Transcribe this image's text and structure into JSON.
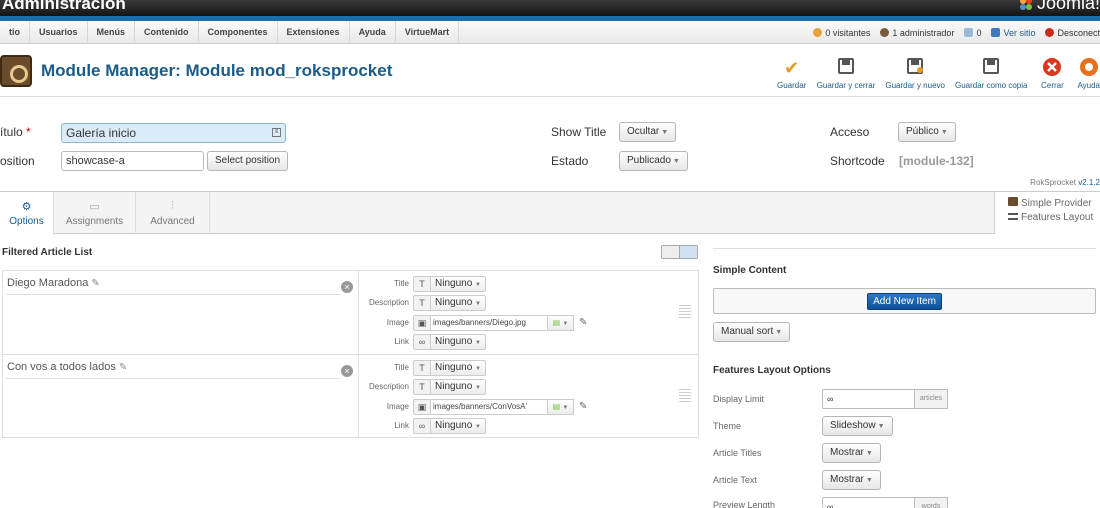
{
  "header": {
    "title": "Administración",
    "brand": "Joomla!"
  },
  "menubar": {
    "items": [
      "tio",
      "Usuarios",
      "Menús",
      "Contenido",
      "Componentes",
      "Extensiones",
      "Ayuda",
      "VirtueMart"
    ],
    "status": {
      "visitors": "0 visitantes",
      "admins": "1 administrador",
      "messages": "0",
      "view_site": "Ver sitio",
      "logout": "Desconect"
    }
  },
  "toolbar": {
    "title": "Module Manager: Module mod_roksprocket",
    "buttons": [
      {
        "label": "Guardar",
        "icon": "check-icon"
      },
      {
        "label": "Guardar y cerrar",
        "icon": "save-icon"
      },
      {
        "label": "Guardar y nuevo",
        "icon": "save-new-icon"
      },
      {
        "label": "Guardar como copia",
        "icon": "save-copy-icon"
      },
      {
        "label": "Cerrar",
        "icon": "close-icon"
      },
      {
        "label": "Ayuda",
        "icon": "help-icon"
      }
    ]
  },
  "form": {
    "title_label": "ítulo",
    "title_required": "*",
    "title_value": "Galería inicio",
    "position_label": "osition",
    "position_value": "showcase-a",
    "select_position": "Select position",
    "show_title_label": "Show Title",
    "show_title_value": "Ocultar",
    "status_label": "Estado",
    "status_value": "Publicado",
    "access_label": "Acceso",
    "access_value": "Público",
    "shortcode_label": "Shortcode",
    "shortcode_value": "[module-132]",
    "version_prefix": "RokSprocket",
    "version": "v2.1.2"
  },
  "tabs": [
    {
      "label": "Options",
      "icon": "gear-icon"
    },
    {
      "label": "Assignments",
      "icon": "monitor-icon"
    },
    {
      "label": "Advanced",
      "icon": "sliders-icon"
    }
  ],
  "provider": {
    "provider": "Simple Provider",
    "layout": "Features Layout"
  },
  "filtered": {
    "title": "Filtered Article List",
    "field_labels": {
      "title": "Title",
      "description": "Description",
      "image": "Image",
      "link": "Link"
    },
    "none": "Ninguno",
    "articles": [
      {
        "title": "Diego Maradona",
        "image_path": "images/banners/Diego.jpg"
      },
      {
        "title": "Con vos a todos lados",
        "image_path": "images/banners/ConVosA'"
      }
    ]
  },
  "simple_content": {
    "title": "Simple Content",
    "add_item": "Add New Item",
    "sort": "Manual sort"
  },
  "features": {
    "title": "Features Layout Options",
    "display_limit_label": "Display Limit",
    "display_limit_value": "∞",
    "display_limit_unit": "articles",
    "theme_label": "Theme",
    "theme_value": "Slideshow",
    "article_titles_label": "Article Titles",
    "article_titles_value": "Mostrar",
    "article_text_label": "Article Text",
    "article_text_value": "Mostrar",
    "preview_length_label": "Preview Length",
    "preview_length_value": "∞",
    "preview_length_unit": "words"
  }
}
